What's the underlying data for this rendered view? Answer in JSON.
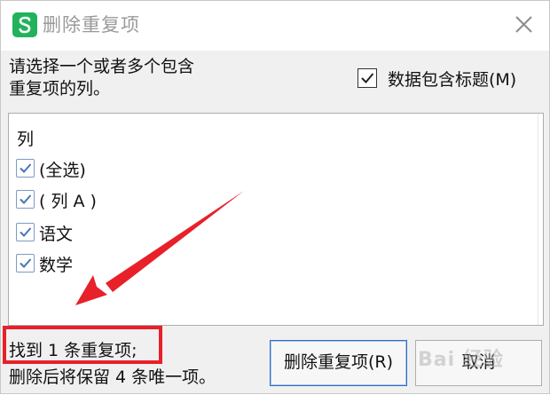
{
  "dialog": {
    "title": "删除重复项",
    "app_icon_letter": "S",
    "prompt_line1": "请选择一个或者多个包含",
    "prompt_line2": "重复项的列。",
    "header_checkbox": {
      "label": "数据包含标题(M)",
      "checked": true
    }
  },
  "column_list": {
    "header": "列",
    "items": [
      {
        "label": "(全选)",
        "checked": true
      },
      {
        "label": "( 列 A )",
        "checked": true
      },
      {
        "label": "语文",
        "checked": true
      },
      {
        "label": "数学",
        "checked": true
      }
    ]
  },
  "status": {
    "found_text": "找到 1 条重复项;",
    "keep_text": "删除后将保留 4 条唯一项。"
  },
  "buttons": {
    "remove_label": "删除重复项(R)",
    "cancel_label": "取消"
  },
  "watermark": {
    "text": "Bai 经验"
  },
  "colors": {
    "accent": "#2f6cc0",
    "checkmark": "#4a76b8",
    "annotation_red": "#e8202a",
    "app_icon_green": "#21b35b"
  },
  "icons": {
    "app": "spreadsheet-app-icon",
    "close": "close-icon",
    "check": "checkmark-icon"
  }
}
